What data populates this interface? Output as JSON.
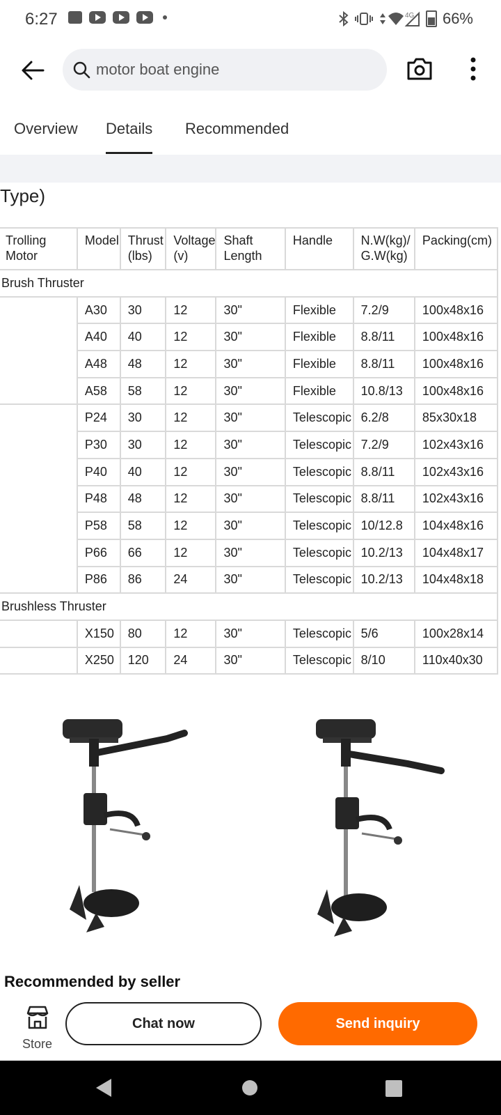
{
  "status_bar": {
    "time": "6:27",
    "network": "4G",
    "battery": "66%"
  },
  "search": {
    "query": "motor boat engine"
  },
  "tabs": [
    {
      "label": "Overview"
    },
    {
      "label": "Details"
    },
    {
      "label": "Recommended"
    }
  ],
  "section_title_tail": "Type)",
  "table": {
    "headers": [
      "Trolling Motor",
      "Model",
      "Thrust (lbs)",
      "Voltage (v)",
      "Shaft Length",
      "Handle",
      "N.W(kg)/ G.W(kg)",
      "Packing(cm)"
    ],
    "groups": [
      {
        "label": "Brush Thruster"
      },
      {
        "label": "Brushless Thruster"
      }
    ],
    "rows": [
      {
        "model": "A30",
        "thrust": "30",
        "voltage": "12",
        "shaft": "30\"",
        "handle": "Flexible",
        "weight": "7.2/9",
        "packing": "100x48x16"
      },
      {
        "model": "A40",
        "thrust": "40",
        "voltage": "12",
        "shaft": "30\"",
        "handle": "Flexible",
        "weight": "8.8/11",
        "packing": "100x48x16"
      },
      {
        "model": "A48",
        "thrust": "48",
        "voltage": "12",
        "shaft": "30\"",
        "handle": "Flexible",
        "weight": "8.8/11",
        "packing": "100x48x16"
      },
      {
        "model": "A58",
        "thrust": "58",
        "voltage": "12",
        "shaft": "30\"",
        "handle": "Flexible",
        "weight": "10.8/13",
        "packing": "100x48x16"
      },
      {
        "model": "P24",
        "thrust": "30",
        "voltage": "12",
        "shaft": "30\"",
        "handle": "Telescopic",
        "weight": "6.2/8",
        "packing": "85x30x18"
      },
      {
        "model": "P30",
        "thrust": "30",
        "voltage": "12",
        "shaft": "30\"",
        "handle": "Telescopic",
        "weight": "7.2/9",
        "packing": "102x43x16"
      },
      {
        "model": "P40",
        "thrust": "40",
        "voltage": "12",
        "shaft": "30\"",
        "handle": "Telescopic",
        "weight": "8.8/11",
        "packing": "102x43x16"
      },
      {
        "model": "P48",
        "thrust": "48",
        "voltage": "12",
        "shaft": "30\"",
        "handle": "Telescopic",
        "weight": "8.8/11",
        "packing": "102x43x16"
      },
      {
        "model": "P58",
        "thrust": "58",
        "voltage": "12",
        "shaft": "30\"",
        "handle": "Telescopic",
        "weight": "10/12.8",
        "packing": "104x48x16"
      },
      {
        "model": "P66",
        "thrust": "66",
        "voltage": "12",
        "shaft": "30\"",
        "handle": "Telescopic",
        "weight": "10.2/13",
        "packing": "104x48x17"
      },
      {
        "model": "P86",
        "thrust": "86",
        "voltage": "24",
        "shaft": "30\"",
        "handle": "Telescopic",
        "weight": "10.2/13",
        "packing": "104x48x18"
      },
      {
        "model": "X150",
        "thrust": "80",
        "voltage": "12",
        "shaft": "30\"",
        "handle": "Telescopic",
        "weight": "5/6",
        "packing": "100x28x14"
      },
      {
        "model": "X250",
        "thrust": "120",
        "voltage": "24",
        "shaft": "30\"",
        "handle": "Telescopic",
        "weight": "8/10",
        "packing": "110x40x30"
      }
    ]
  },
  "recommended_title": "Recommended by seller",
  "actions": {
    "store_label": "Store",
    "chat_label": "Chat now",
    "inquiry_label": "Send inquiry"
  },
  "colors": {
    "accent": "#ff6a00",
    "tab_underline": "#222222",
    "band": "#f2f3f6"
  }
}
